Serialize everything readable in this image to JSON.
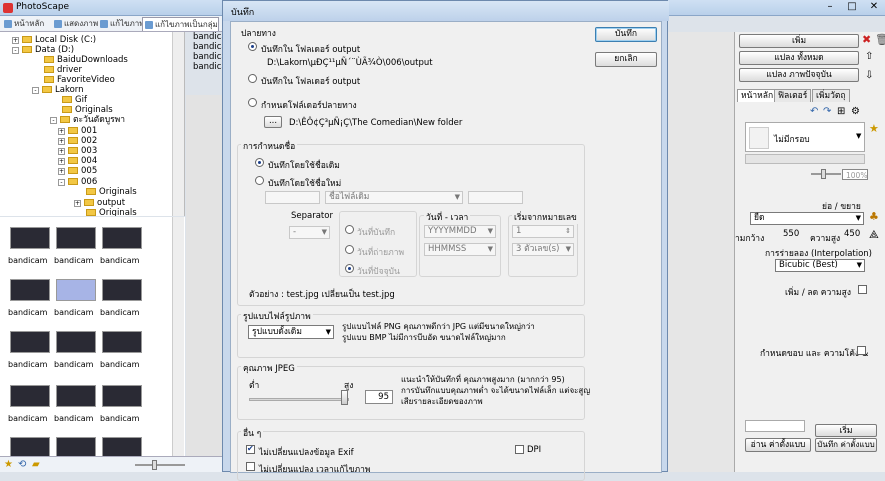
{
  "app": {
    "title": "PhotoScape",
    "tabs": [
      "หน้าหลัก",
      "แสดงภาพ",
      "แก้ไขภาพ",
      "แก้ไขภาพเป็นกลุ่ม"
    ]
  },
  "tree": [
    {
      "label": "Local Disk (C:)",
      "exp": "+"
    },
    {
      "label": "Data (D:)",
      "exp": "-"
    },
    {
      "label": "BaiduDownloads",
      "exp": ""
    },
    {
      "label": "driver",
      "exp": ""
    },
    {
      "label": "FavoriteVideo",
      "exp": ""
    },
    {
      "label": "Lakorn",
      "exp": "-"
    },
    {
      "label": "Gif",
      "exp": ""
    },
    {
      "label": "Originals",
      "exp": ""
    },
    {
      "label": "ตะวันตัดบูรพา",
      "exp": "-"
    },
    {
      "label": "001",
      "exp": "+"
    },
    {
      "label": "002",
      "exp": "+"
    },
    {
      "label": "003",
      "exp": "+"
    },
    {
      "label": "004",
      "exp": "+"
    },
    {
      "label": "005",
      "exp": "+"
    },
    {
      "label": "006",
      "exp": "-"
    },
    {
      "label": "Originals",
      "exp": ""
    },
    {
      "label": "output",
      "exp": "+"
    },
    {
      "label": "Originals",
      "exp": ""
    }
  ],
  "file_list": [
    "bandicam",
    "bandicam",
    "bandicam",
    "bandicam"
  ],
  "thumb_label": "bandicam",
  "dialog": {
    "title": "บันทึก",
    "save_button": "บันทึก",
    "cancel_button": "ยกเลิก",
    "dest_group": "ปลายทาง",
    "dest_opt1": "บันทึกใน  โฟลเดอร์ output",
    "dest_path1": "D:\\Lakorn\\µÐÇ¹¹µÑ´¨ÙÃ¾Ò\\006\\output",
    "dest_opt2": "บันทึกใน  โฟลเดอร์ output",
    "dest_opt3": "กำหนดโฟล์เดอร์ปลายทาง",
    "browse_button": "...",
    "dest_path3": "D:\\ÊÔ¢Ç³µÑ¡Ç\\The Comedian\\New folder",
    "name_group": "การกำหนดชื่อ",
    "name_opt1": "บันทึกโดยใช้ชื่อเดิม",
    "name_opt2": "บันทึกโดยใช้ชื่อใหม่",
    "name_select": "ชื่อไฟล์เดิม",
    "separator_label": "Separator",
    "separator_value": "-",
    "date_opt1": "วันที่บันทึก",
    "date_opt2": "วันที่ถ่ายภาพ",
    "date_opt3": "วันที่ปัจจุบัน",
    "datetime_label": "วันที่ - เวลา",
    "date_format": "YYYYMMDD",
    "time_format": "HHMMSS",
    "startnum_label": "เริ่มจากหมายเลข",
    "start_value": "1",
    "digits_value": "3 ตัวเลข(s)",
    "example": "ตัวอย่าง : test.jpg เปลี่ยนเป็น test.jpg",
    "format_group": "รูปแบบไฟล์รูปภาพ",
    "format_value": "รูปแบบดั้งเดิม",
    "format_note1": "รูปแบบไฟล์ PNG คุณภาพดีกว่า JPG แต่มีขนาดใหญ่กว่า",
    "format_note2": "รูปแบบ BMP ไม่มีการบีบอัด ขนาดไฟล์ใหญ่มาก",
    "jpeg_group": "คุณภาพ JPEG",
    "low_label": "ต่ำ",
    "high_label": "สูง",
    "quality_value": "95",
    "quality_fraction": 0.95,
    "jpeg_note1": "แนะนำให้บันทึกที่ คุณภาพสูงมาก (มากกว่า 95)",
    "jpeg_note2": "การบันทึกแบบคุณภาพต่ำ จะได้ขนาดไฟล์เล็ก แต่จะสูญ",
    "jpeg_note3": "เสียรายละเอียดของภาพ",
    "etc_group": "อื่น ๆ",
    "exif_label": "ไม่เปลี่ยนแปลงข้อมูล Exif",
    "dpi_label": "DPI",
    "time_label": "ไม่เปลี่ยนแปลง เวลาแก้ไขภาพ"
  },
  "right_panel": {
    "add_button": "เพิ่ม",
    "change_all_button": "แปลง ทั้งหมด",
    "change_current_button": "แปลง ภาพปัจจุบัน",
    "tab1": "หน้าหลัก",
    "tab2": "ฟิลเตอร์",
    "tab3": "เพิ่มวัตถุ",
    "frame_select": "ไม่มีกรอบ",
    "zoom_percent": "100%",
    "resize_label": "ย่อ / ขยาย",
    "resize_select": "ยืด",
    "width_label": "ามกว้าง",
    "width_value": "550",
    "height_label": "ความสูง",
    "height_value": "450",
    "interp_label": "การร่ายลอง (Interpolation)",
    "interp_select": "Bicubic (Best)",
    "sharpen_label": "เพิ่ม / ลด ความสูง",
    "border_label": "กำหนดขอบ และ ความโค้ง  &",
    "go_button": "เริ่ม",
    "load_button": "อ่าน ค่าตั้งแบบ",
    "save_button": "บันทึก ค่าตั้งแบบ"
  },
  "colors": {
    "accent": "#1b3f8a",
    "selection": "#a7b4e6",
    "folder": "#f2c744"
  }
}
